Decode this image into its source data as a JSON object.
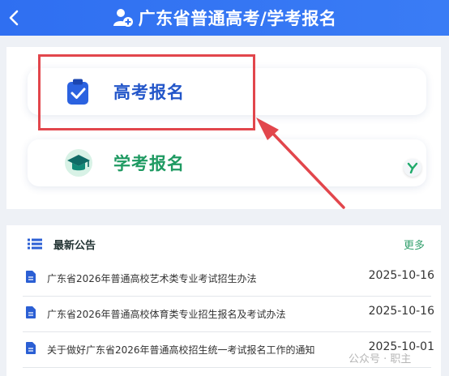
{
  "header": {
    "title": "广东省普通高考/学考报名",
    "back_icon": "chevron-left-icon",
    "title_icon": "user-add-icon",
    "bg_color": "#2f6ff1"
  },
  "options": [
    {
      "label": "高考报名",
      "icon": "clipboard-check-icon",
      "color": "#2356c9"
    },
    {
      "label": "学考报名",
      "icon": "graduation-cap-icon",
      "color": "#1f9a62"
    }
  ],
  "notices": {
    "title": "最新公告",
    "more_label": "更多",
    "items": [
      {
        "text": "广东省2026年普通高校艺术类专业考试招生办法",
        "date": "2025-10-16"
      },
      {
        "text": "广东省2026年普通高校体育类专业招生报名及考试办法",
        "date": "2025-10-16"
      },
      {
        "text": "关于做好广东省2026年普通高校招生统一考试报名工作的通知",
        "date": "2025-10-01"
      }
    ]
  },
  "annotation": {
    "color": "#e2464c"
  },
  "watermark": "公众号 · 职主"
}
